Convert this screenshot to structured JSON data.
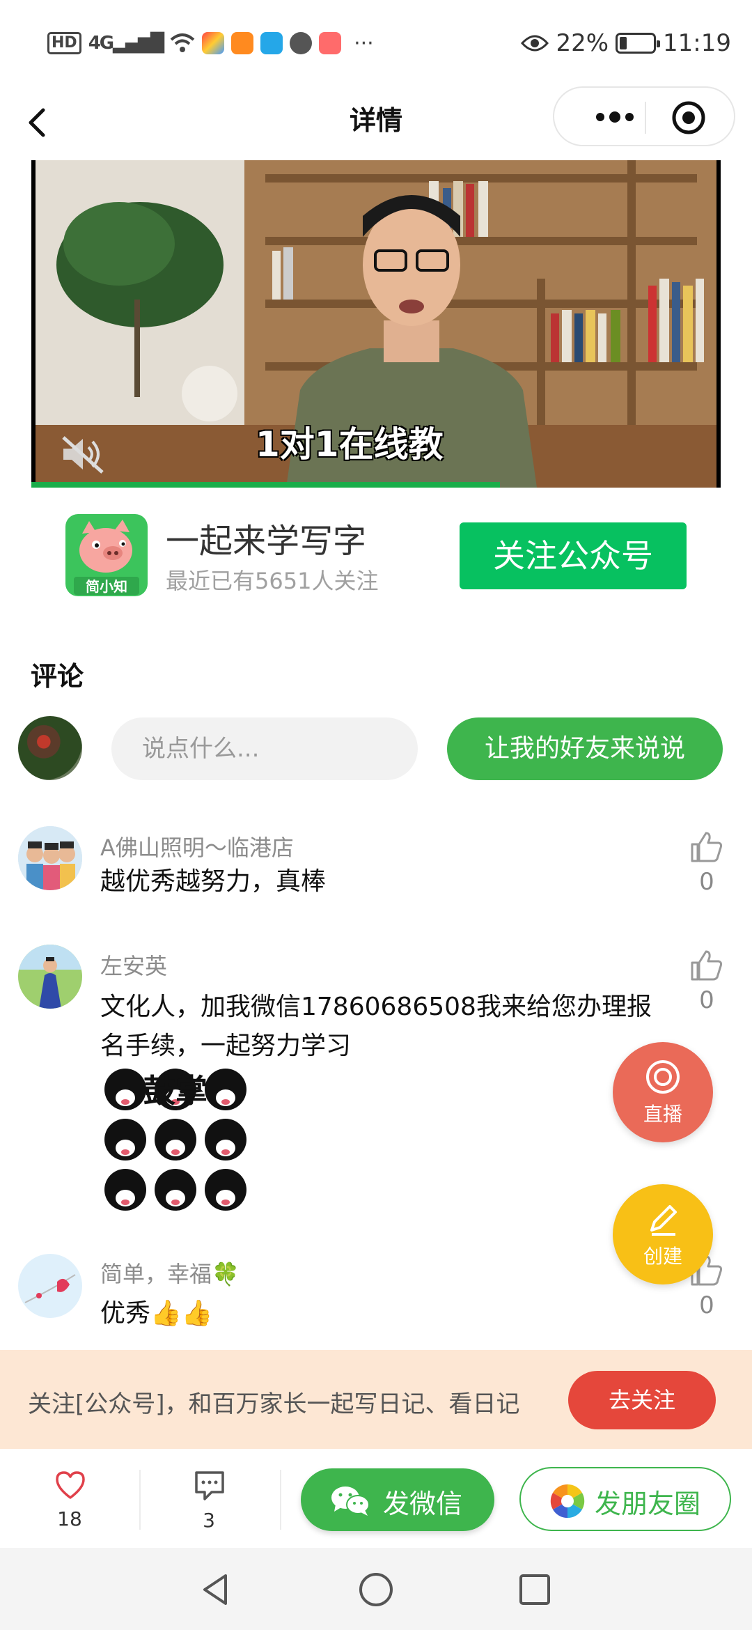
{
  "status_bar": {
    "hd": "HD",
    "network": "4G",
    "more": "···",
    "battery_text": "22%",
    "battery_level": 0.22,
    "time": "11:19"
  },
  "nav": {
    "title": "详情"
  },
  "video": {
    "caption": "1对1在线教",
    "progress": 0.68
  },
  "account": {
    "logo_text": "简小知",
    "name": "一起来学写字",
    "subtitle": "最近已有5651人关注",
    "follow_label": "关注公众号"
  },
  "comments_section": {
    "title": "评论",
    "input_placeholder": "说点什么...",
    "friends_button": "让我的好友来说说",
    "items": [
      {
        "name": "A佛山照明～临港店",
        "text": "越优秀越努力，真棒",
        "likes": "0"
      },
      {
        "name": "左安英",
        "text": "文化人，加我微信17860686508我来给您办理报名手续，一起努力学习",
        "sticker_text": "鼓掌",
        "likes": "0"
      },
      {
        "name": "简单，幸福🍀",
        "text": "优秀👍👍",
        "likes": "0"
      }
    ]
  },
  "fabs": {
    "live_label": "直播",
    "create_label": "创建"
  },
  "banner": {
    "text": "关注[公众号]，和百万家长一起写日记、看日记",
    "button": "去关注"
  },
  "action_bar": {
    "likes": "18",
    "comments": "3",
    "wechat_label": "发微信",
    "moments_label": "发朋友圈"
  },
  "colors": {
    "green": "#07c160",
    "banner_bg": "#fde7d4",
    "banner_button": "#e5473b",
    "live_fab": "#ea6a58",
    "create_fab": "#f8c016"
  }
}
